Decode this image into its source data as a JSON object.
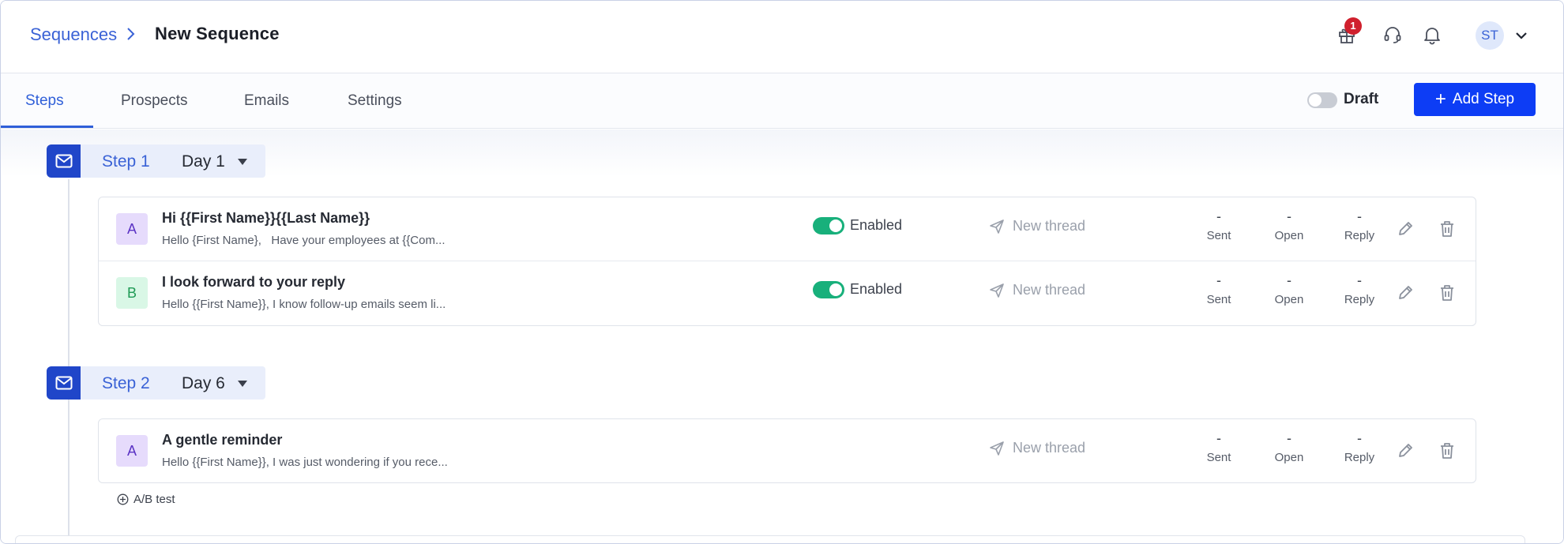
{
  "header": {
    "breadcrumb_link": "Sequences",
    "breadcrumb_current": "New Sequence",
    "gift_badge_count": "1",
    "avatar_initials": "ST"
  },
  "tabs": [
    {
      "label": "Steps",
      "active": true
    },
    {
      "label": "Prospects",
      "active": false
    },
    {
      "label": "Emails",
      "active": false
    },
    {
      "label": "Settings",
      "active": false
    }
  ],
  "toolbar": {
    "draft_label": "Draft",
    "draft_enabled": false,
    "add_step_label": "Add Step"
  },
  "steps": [
    {
      "name": "Step 1",
      "day": "Day 1",
      "emails": [
        {
          "variant": "A",
          "subject": "Hi {{First Name}}{{Last Name}}",
          "preview": "Hello {First Name},   Have your employees at {{Com...",
          "status": "Enabled",
          "thread": "New thread",
          "sent": "-",
          "open": "-",
          "reply": "-"
        },
        {
          "variant": "B",
          "subject": "I look forward to your reply",
          "preview": "Hello {{First Name}}, I know follow-up emails seem li...",
          "status": "Enabled",
          "thread": "New thread",
          "sent": "-",
          "open": "-",
          "reply": "-"
        }
      ]
    },
    {
      "name": "Step 2",
      "day": "Day 6",
      "emails": [
        {
          "variant": "A",
          "subject": "A gentle reminder",
          "preview": "Hello {{First Name}}, I was just wondering if you rece...",
          "status": "",
          "thread": "New thread",
          "sent": "-",
          "open": "-",
          "reply": "-"
        }
      ]
    }
  ],
  "stat_labels": {
    "sent": "Sent",
    "open": "Open",
    "reply": "Reply"
  },
  "ab_test_label": "A/B test",
  "colors": {
    "accent": "#2f5fd8",
    "primary_button": "#0d3df5",
    "enabled_toggle": "#18b07b",
    "badge": "#d0202d"
  },
  "icons": {
    "step": "mail-icon",
    "thread": "send-icon",
    "edit": "pencil-icon",
    "delete": "trash-icon"
  }
}
